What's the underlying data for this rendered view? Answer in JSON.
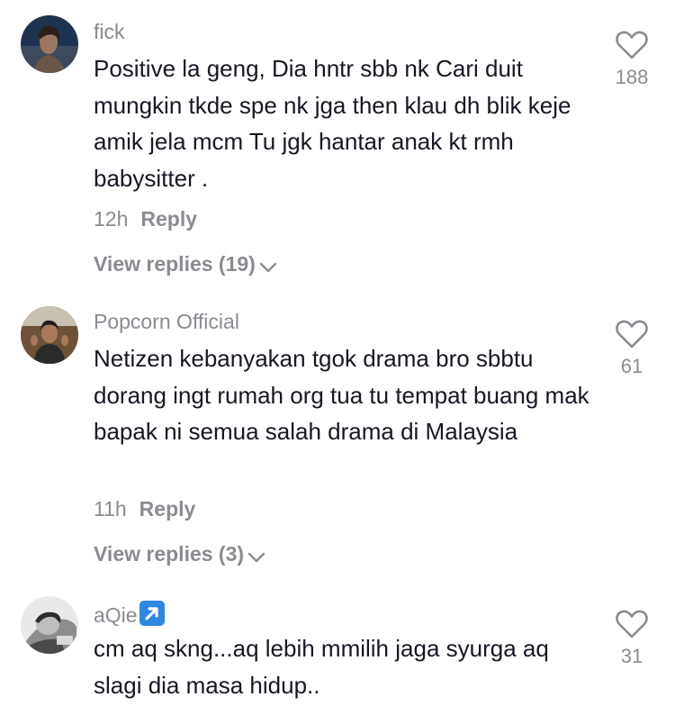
{
  "comments": [
    {
      "username": "fick",
      "text": "Positive la geng, Dia hntr sbb nk Cari duit mungkin tkde spe nk jga then klau dh blik keje amik jela mcm Tu jgk hantar anak kt rmh babysitter .",
      "time": "12h",
      "reply_label": "Reply",
      "view_replies": "View replies (19)",
      "likes": "188"
    },
    {
      "username": "Popcorn Official",
      "text": "Netizen kebanyakan tgok drama bro sbbtu dorang ingt rumah org tua tu tempat buang mak bapak ni semua salah drama di Malaysia",
      "time": "11h",
      "reply_label": "Reply",
      "view_replies": "View replies (3)",
      "likes": "61"
    },
    {
      "username": "aQie",
      "username_badge": "up-right-arrow-icon",
      "text": "cm aq skng...aq lebih mmilih jaga syurga aq slagi dia masa hidup..",
      "likes": "31"
    }
  ],
  "colors": {
    "primary_text": "#161823",
    "secondary_text": "#8a8b91",
    "badge_blue": "#2e86e0"
  }
}
